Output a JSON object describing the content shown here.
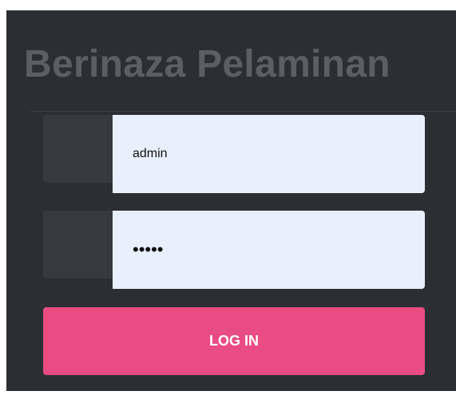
{
  "title": "Berinaza Pelaminan",
  "form": {
    "username_value": "admin",
    "password_value": "•••••",
    "login_label": "LOG IN"
  },
  "colors": {
    "panel": "#2b2f34",
    "title": "#5b5f63",
    "input_bg": "#e8f0fe",
    "button": "#e94b83"
  }
}
